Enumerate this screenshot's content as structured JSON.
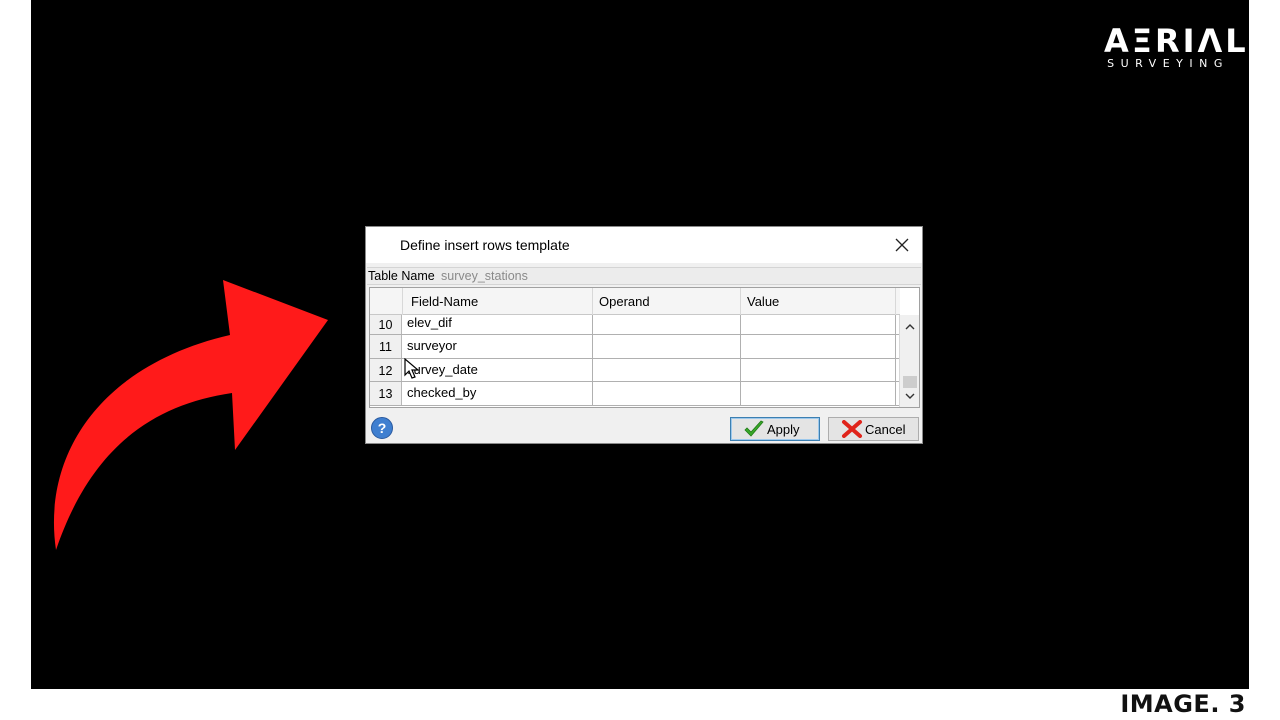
{
  "logo": {
    "word": "AΞRIΛL",
    "sub": "SURVEYING"
  },
  "caption": "IMAGE. 3",
  "dialog": {
    "title": "Define insert rows template",
    "table_name_label": "Table Name",
    "table_name_value": "survey_stations",
    "columns": [
      "Field-Name",
      "Operand",
      "Value"
    ],
    "rows": [
      {
        "num": "10",
        "field": "elev_dif",
        "operand": "",
        "value": ""
      },
      {
        "num": "11",
        "field": "surveyor",
        "operand": "",
        "value": ""
      },
      {
        "num": "12",
        "field": "survey_date",
        "operand": "",
        "value": ""
      },
      {
        "num": "13",
        "field": "checked_by",
        "operand": "",
        "value": ""
      }
    ],
    "apply_label": "Apply",
    "cancel_label": "Cancel",
    "help_label": "?"
  },
  "colors": {
    "arrow": "#ff1a1a",
    "background": "#000000",
    "apply_border": "#3c7fb1"
  },
  "icons": [
    "close-icon",
    "help-icon",
    "check-icon",
    "cross-icon",
    "chevron-up-icon",
    "chevron-down-icon",
    "mouse-pointer-icon",
    "curved-arrow-icon"
  ]
}
